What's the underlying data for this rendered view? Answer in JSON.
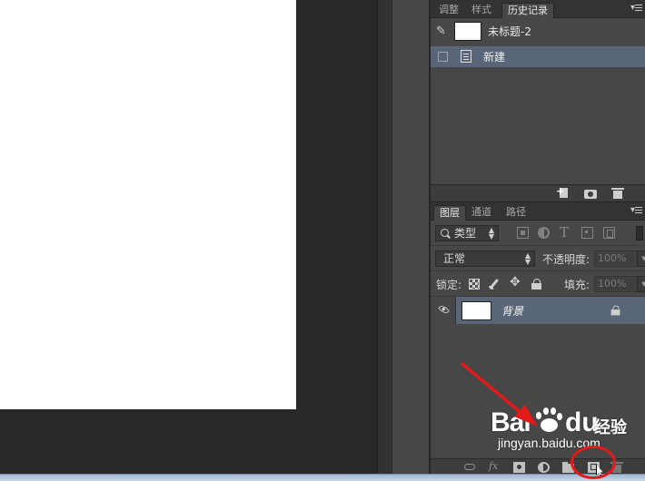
{
  "history_panel": {
    "tabs": [
      {
        "label": "调整"
      },
      {
        "label": "样式"
      },
      {
        "label": "历史记录"
      }
    ],
    "snapshot_label": "未标题-2",
    "states": [
      {
        "label": "新建"
      }
    ]
  },
  "layers_panel": {
    "tabs": [
      {
        "label": "图层"
      },
      {
        "label": "通道"
      },
      {
        "label": "路径"
      }
    ],
    "filter_kind": "类型",
    "blend_mode": "正常",
    "opacity_label": "不透明度:",
    "opacity_value": "100%",
    "lock_label": "锁定:",
    "fill_label": "填充:",
    "fill_value": "100%",
    "layers": [
      {
        "name": "背景",
        "visible": true,
        "locked": true
      }
    ]
  },
  "watermark": {
    "brand_latin_1": "Bai",
    "brand_latin_2": "du",
    "brand_cn": "经验",
    "url": "jingyan.baidu.com"
  },
  "annotation": {
    "color": "#e31a1a"
  }
}
